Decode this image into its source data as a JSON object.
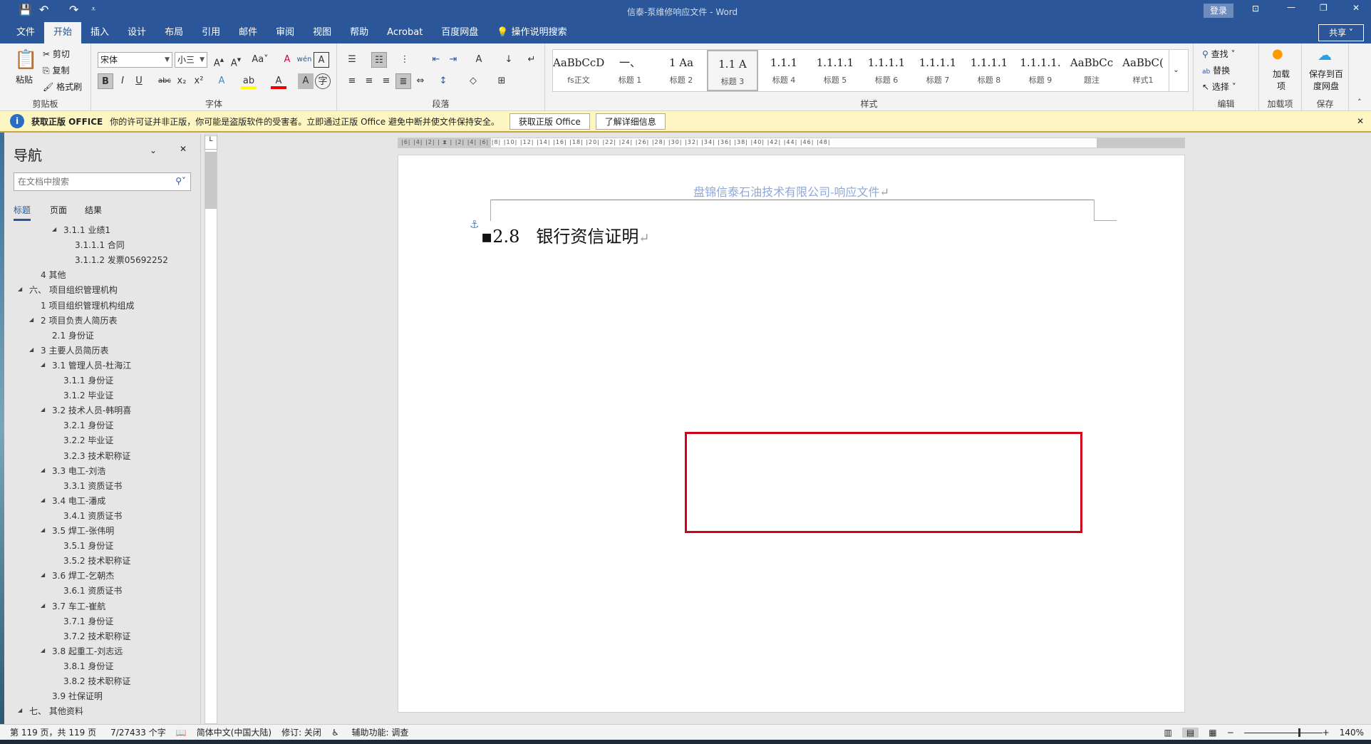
{
  "title": {
    "doc": "信泰-泵维修响应文件",
    "app": "Word",
    "sep": " - ",
    "login": "登录"
  },
  "tabs": [
    "文件",
    "开始",
    "插入",
    "设计",
    "布局",
    "引用",
    "邮件",
    "审阅",
    "视图",
    "帮助",
    "Acrobat",
    "百度网盘"
  ],
  "tell_me": "操作说明搜索",
  "share": "共享",
  "clipboard": {
    "paste": "粘贴",
    "cut": "剪切",
    "copy": "复制",
    "format_painter": "格式刷",
    "label": "剪贴板"
  },
  "font": {
    "name": "宋体",
    "size": "小三",
    "label": "字体"
  },
  "paragraph": {
    "label": "段落"
  },
  "styles": {
    "label": "样式",
    "items": [
      {
        "preview": "AaBbCcDdI",
        "name": "fs正文"
      },
      {
        "preview": "一、",
        "name": "标题 1"
      },
      {
        "preview": "1  Aa",
        "name": "标题 2"
      },
      {
        "preview": "1.1 A",
        "name": "标题 3"
      },
      {
        "preview": "1.1.1",
        "name": "标题 4"
      },
      {
        "preview": "1.1.1.1",
        "name": "标题 5"
      },
      {
        "preview": "1.1.1.1",
        "name": "标题 6"
      },
      {
        "preview": "1.1.1.1",
        "name": "标题 7"
      },
      {
        "preview": "1.1.1.1",
        "name": "标题 8"
      },
      {
        "preview": "1.1.1.1.",
        "name": "标题 9"
      },
      {
        "preview": "AaBbCc",
        "name": "题注"
      },
      {
        "preview": "AaBbC(",
        "name": "样式1"
      }
    ]
  },
  "editing": {
    "find": "查找",
    "replace": "替换",
    "select": "选择",
    "label": "编辑"
  },
  "addins": {
    "btn": "加载项",
    "label": "加载项"
  },
  "save_baidu": {
    "btn": "保存到百度网盘",
    "label": "保存"
  },
  "message": {
    "title": "获取正版 OFFICE",
    "text": "你的许可证并非正版，你可能是盗版软件的受害者。立即通过正版 Office 避免中断并使文件保持安全。",
    "btn1": "获取正版 Office",
    "btn2": "了解详细信息"
  },
  "nav": {
    "title": "导航",
    "search_placeholder": "在文档中搜索",
    "tabs": [
      "标题",
      "页面",
      "结果"
    ],
    "items": [
      {
        "t": "3.1.1 业绩1",
        "l": 3,
        "c": 1
      },
      {
        "t": "3.1.1.1 合同",
        "l": 4,
        "c": 0
      },
      {
        "t": "3.1.1.2 发票05692252",
        "l": 4,
        "c": 0
      },
      {
        "t": "4 其他",
        "l": 1,
        "c": 0
      },
      {
        "t": "六、 项目组织管理机构",
        "l": 0,
        "c": 1
      },
      {
        "t": "1 项目组织管理机构组成",
        "l": 1,
        "c": 0
      },
      {
        "t": "2 项目负责人简历表",
        "l": 1,
        "c": 1
      },
      {
        "t": "2.1 身份证",
        "l": 2,
        "c": 0
      },
      {
        "t": "3 主要人员简历表",
        "l": 1,
        "c": 1
      },
      {
        "t": "3.1 管理人员-杜海江",
        "l": 2,
        "c": 1
      },
      {
        "t": "3.1.1 身份证",
        "l": 3,
        "c": 0
      },
      {
        "t": "3.1.2 毕业证",
        "l": 3,
        "c": 0
      },
      {
        "t": "3.2 技术人员-韩明喜",
        "l": 2,
        "c": 1
      },
      {
        "t": "3.2.1 身份证",
        "l": 3,
        "c": 0
      },
      {
        "t": "3.2.2 毕业证",
        "l": 3,
        "c": 0
      },
      {
        "t": "3.2.3 技术职称证",
        "l": 3,
        "c": 0
      },
      {
        "t": "3.3 电工-刘浩",
        "l": 2,
        "c": 1
      },
      {
        "t": "3.3.1 资质证书",
        "l": 3,
        "c": 0
      },
      {
        "t": "3.4 电工-潘成",
        "l": 2,
        "c": 1
      },
      {
        "t": "3.4.1 资质证书",
        "l": 3,
        "c": 0
      },
      {
        "t": "3.5 焊工-张伟明",
        "l": 2,
        "c": 1
      },
      {
        "t": "3.5.1 身份证",
        "l": 3,
        "c": 0
      },
      {
        "t": "3.5.2 技术职称证",
        "l": 3,
        "c": 0
      },
      {
        "t": "3.6 焊工-乞朝杰",
        "l": 2,
        "c": 1
      },
      {
        "t": "3.6.1 资质证书",
        "l": 3,
        "c": 0
      },
      {
        "t": "3.7 车工-崔航",
        "l": 2,
        "c": 1
      },
      {
        "t": "3.7.1 身份证",
        "l": 3,
        "c": 0
      },
      {
        "t": "3.7.2 技术职称证",
        "l": 3,
        "c": 0
      },
      {
        "t": "3.8 起重工-刘志远",
        "l": 2,
        "c": 1
      },
      {
        "t": "3.8.1 身份证",
        "l": 3,
        "c": 0
      },
      {
        "t": "3.8.2 技术职称证",
        "l": 3,
        "c": 0
      },
      {
        "t": "3.9 社保证明",
        "l": 2,
        "c": 0
      },
      {
        "t": "七、 其他资料",
        "l": 0,
        "c": 1
      }
    ]
  },
  "document": {
    "header": "盘锦信泰石油技术有限公司-响应文件",
    "heading_num": "2.8",
    "heading_text": "银行资信证明",
    "para_mark": "↵"
  },
  "status": {
    "page": "第 119 页，共 119 页",
    "words": "7/27433 个字",
    "lang": "简体中文(中国大陆)",
    "track": "修订: 关闭",
    "access": "辅助功能: 调查",
    "zoom": "140%"
  },
  "colors": {
    "accent": "#2b579a",
    "annotation": "#d0021b",
    "header_text": "#8fa8d8"
  }
}
